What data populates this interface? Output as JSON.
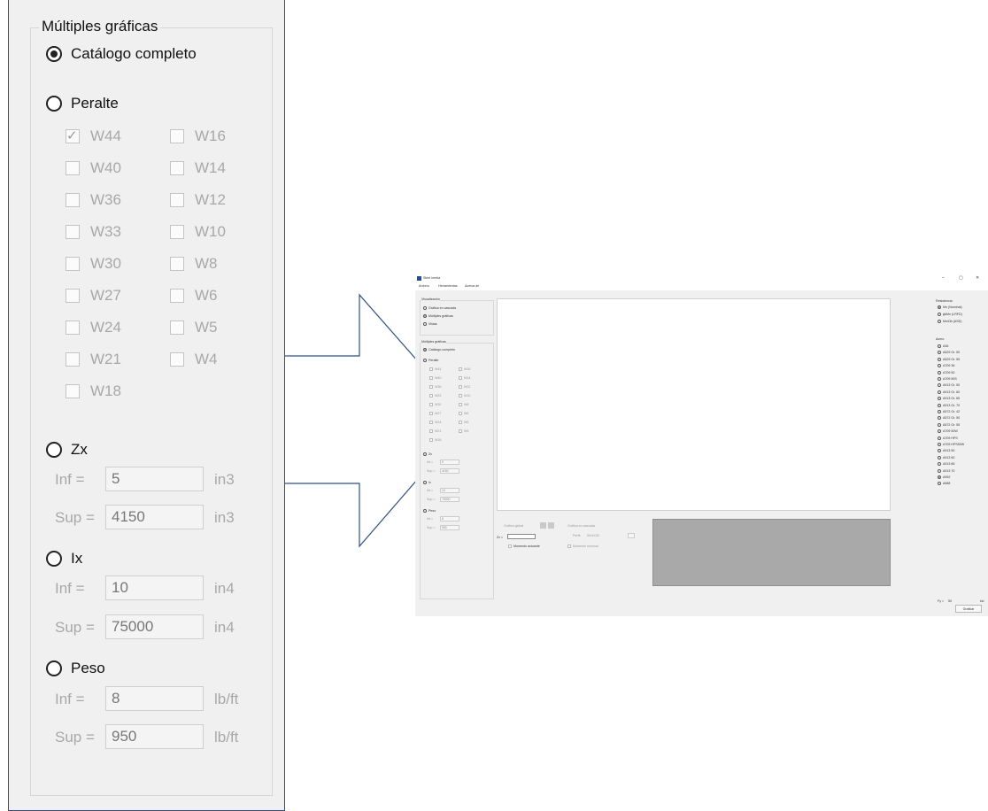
{
  "panel": {
    "legend": "Múltiples gráficas",
    "catalog_label": "Catálogo completo",
    "peralte_label": "Peralte",
    "sections": [
      {
        "label": "W44",
        "checked": true
      },
      {
        "label": "W40",
        "checked": false
      },
      {
        "label": "W36",
        "checked": false
      },
      {
        "label": "W33",
        "checked": false
      },
      {
        "label": "W30",
        "checked": false
      },
      {
        "label": "W27",
        "checked": false
      },
      {
        "label": "W24",
        "checked": false
      },
      {
        "label": "W21",
        "checked": false
      },
      {
        "label": "W18",
        "checked": false
      },
      {
        "label": "W16",
        "checked": false
      },
      {
        "label": "W14",
        "checked": false
      },
      {
        "label": "W12",
        "checked": false
      },
      {
        "label": "W10",
        "checked": false
      },
      {
        "label": "W8",
        "checked": false
      },
      {
        "label": "W6",
        "checked": false
      },
      {
        "label": "W5",
        "checked": false
      },
      {
        "label": "W4",
        "checked": false
      }
    ],
    "inf_label": "Inf =",
    "sup_label": "Sup =",
    "zx": {
      "label": "Zx",
      "inf": "5",
      "sup": "4150",
      "unit": "in3"
    },
    "ix": {
      "label": "Ix",
      "inf": "10",
      "sup": "75000",
      "unit": "in4"
    },
    "peso": {
      "label": "Peso",
      "inf": "8",
      "sup": "950",
      "unit": "lb/ft"
    }
  },
  "app": {
    "title": "Steel Inertia",
    "window_controls": [
      "–",
      "▢",
      "✕"
    ],
    "menu": [
      "Archivo",
      "Herramientas",
      "Acerca de"
    ],
    "visual": {
      "legend": "Visualización",
      "options": [
        "Gráfica en cascada",
        "Múltiples gráficas",
        "Vistas"
      ]
    },
    "multi": {
      "legend": "Múltiples gráficas",
      "catalog": "Catálogo completo",
      "peralte": "Peralte"
    },
    "small_zx": {
      "label": "Zx",
      "inf": "5",
      "sup": "4150"
    },
    "small_ix": {
      "label": "Ix",
      "inf": "10",
      "sup": "75000"
    },
    "small_peso": {
      "label": "Peso",
      "inf": "8",
      "sup": "950"
    },
    "bottom": {
      "grafica_global": "Gráfica global",
      "zx_label": "Zx =",
      "momento": "Momento actuante",
      "grafica_cascada": "Gráfica en cascada",
      "perfil": "Perfil:",
      "perfil_value": "W14X30",
      "momento_nominal": "Momento nominal"
    },
    "resistencia": {
      "legend": "Resistencia",
      "options": [
        "Mn (Nominal)",
        "ϕbMn (LRFD)",
        "Mn/Ωb (ASD)"
      ]
    },
    "acero": {
      "legend": "Acero",
      "options": [
        "A36",
        "A529 Gr. 50",
        "A529 Gr. 55",
        "A709 36",
        "A709 50",
        "A709 50S",
        "A913 Gr. 50",
        "A913 Gr. 60",
        "A913 Gr. 65",
        "A913 Gr. 70",
        "A572 Gr. 42",
        "A572 Gr. 50",
        "A572 Gr. 55",
        "A709 50W",
        "A709 HPS",
        "A709 HPS50W",
        "A913 50",
        "A913 60",
        "A913 65",
        "A913 70",
        "A992",
        "A588"
      ],
      "selected": "A992"
    },
    "fy_label": "Fy =",
    "fy_value": "50",
    "fy_unit": "ksi",
    "graficar": "Graficar"
  },
  "colors": {
    "panel_border": "#2f4f86",
    "arrow": "#2f4f86",
    "preview": "#a9a9a9",
    "bg": "#f0f0f0"
  }
}
